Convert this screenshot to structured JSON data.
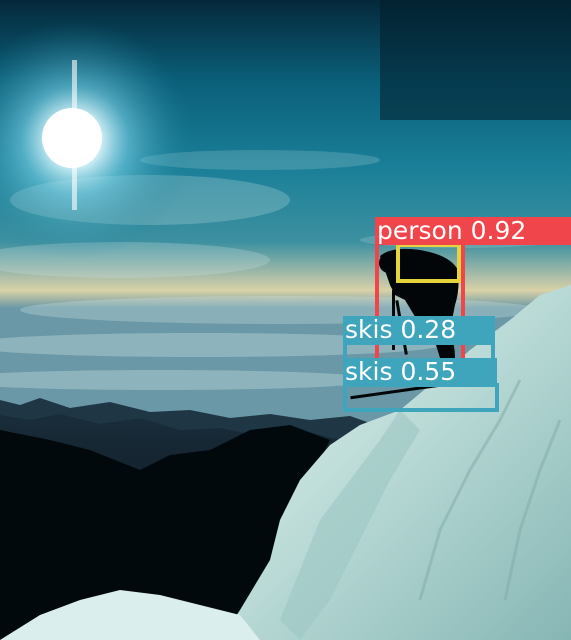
{
  "detections": [
    {
      "label": "person",
      "score": "0.92",
      "color": "#f0454a"
    },
    {
      "label": "skis",
      "score": "0.28",
      "color": "#3ea5bd"
    },
    {
      "label": "skis",
      "score": "0.55",
      "color": "#3ea5bd"
    }
  ],
  "extra_box_color": "#e7d33b",
  "content": {
    "elements": [
      "sky",
      "sun",
      "clouds",
      "mountain-range",
      "snow-slope",
      "skier"
    ]
  }
}
